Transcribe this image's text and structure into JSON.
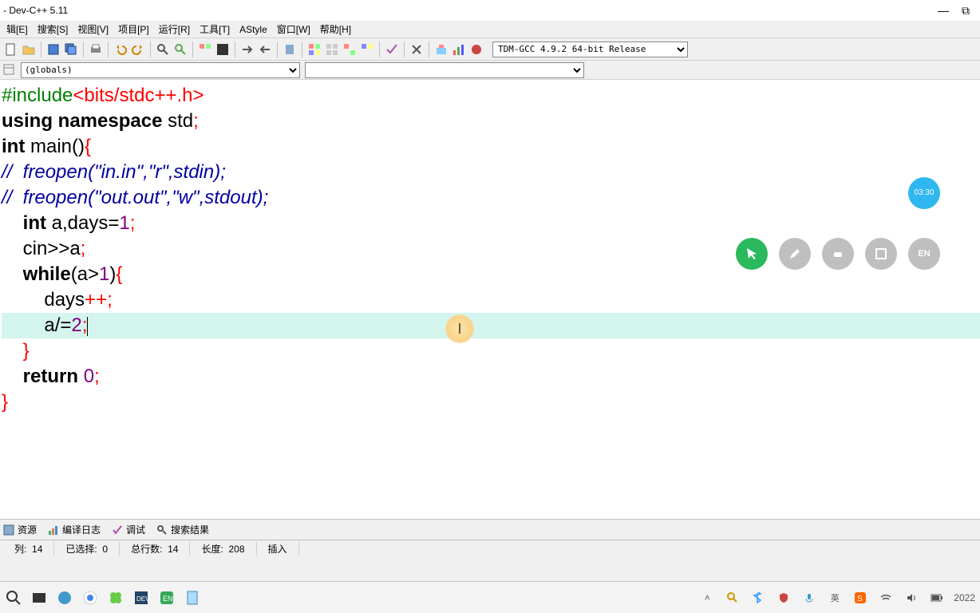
{
  "title": "- Dev-C++ 5.11",
  "menu": {
    "items": [
      "辑[E]",
      "搜索[S]",
      "视图[V]",
      "项目[P]",
      "运行[R]",
      "工具[T]",
      "AStyle",
      "窗口[W]",
      "帮助[H]"
    ]
  },
  "compiler_select": "TDM-GCC 4.9.2 64-bit Release",
  "globals_select": "(globals)",
  "overlay": {
    "timer": "03:30",
    "cursor_glyph": "I"
  },
  "code": {
    "l1_pre": "#include",
    "l1_tgt": "<bits/stdc++.h>",
    "l2_a": "using",
    "l2_b": "namespace",
    "l2_c": "std",
    "l3_a": "int",
    "l3_b": "main",
    "l4_a": "//",
    "l4_b": "  freopen(",
    "l4_s1": "\"in.in\"",
    "l4_c": ",",
    "l4_s2": "\"r\"",
    "l4_d": ",stdin);",
    "l5_a": "//",
    "l5_b": "  freopen(",
    "l5_s1": "\"out.out\"",
    "l5_c": ",",
    "l5_s2": "\"w\"",
    "l5_d": ",stdout);",
    "l6_a": "int",
    "l6_b": " a,days=",
    "l6_n": "1",
    "l7": "cin>>a",
    "l8_a": "while",
    "l8_b": "(a>",
    "l8_n": "1",
    "l8_c": ")",
    "l9": "days",
    "l10_a": "a/=",
    "l10_n": "2",
    "l12_a": "return",
    "l12_n": "0"
  },
  "bottom_tabs": {
    "t1": "资源",
    "t2": "编译日志",
    "t3": "调试",
    "t4": "搜索结果"
  },
  "status": {
    "col_label": "列:",
    "col": "14",
    "sel_label": "已选择:",
    "sel": "0",
    "lines_label": "总行数:",
    "lines": "14",
    "len_label": "长度:",
    "len": "208",
    "mode": "插入"
  },
  "taskbar": {
    "year": "2022"
  }
}
